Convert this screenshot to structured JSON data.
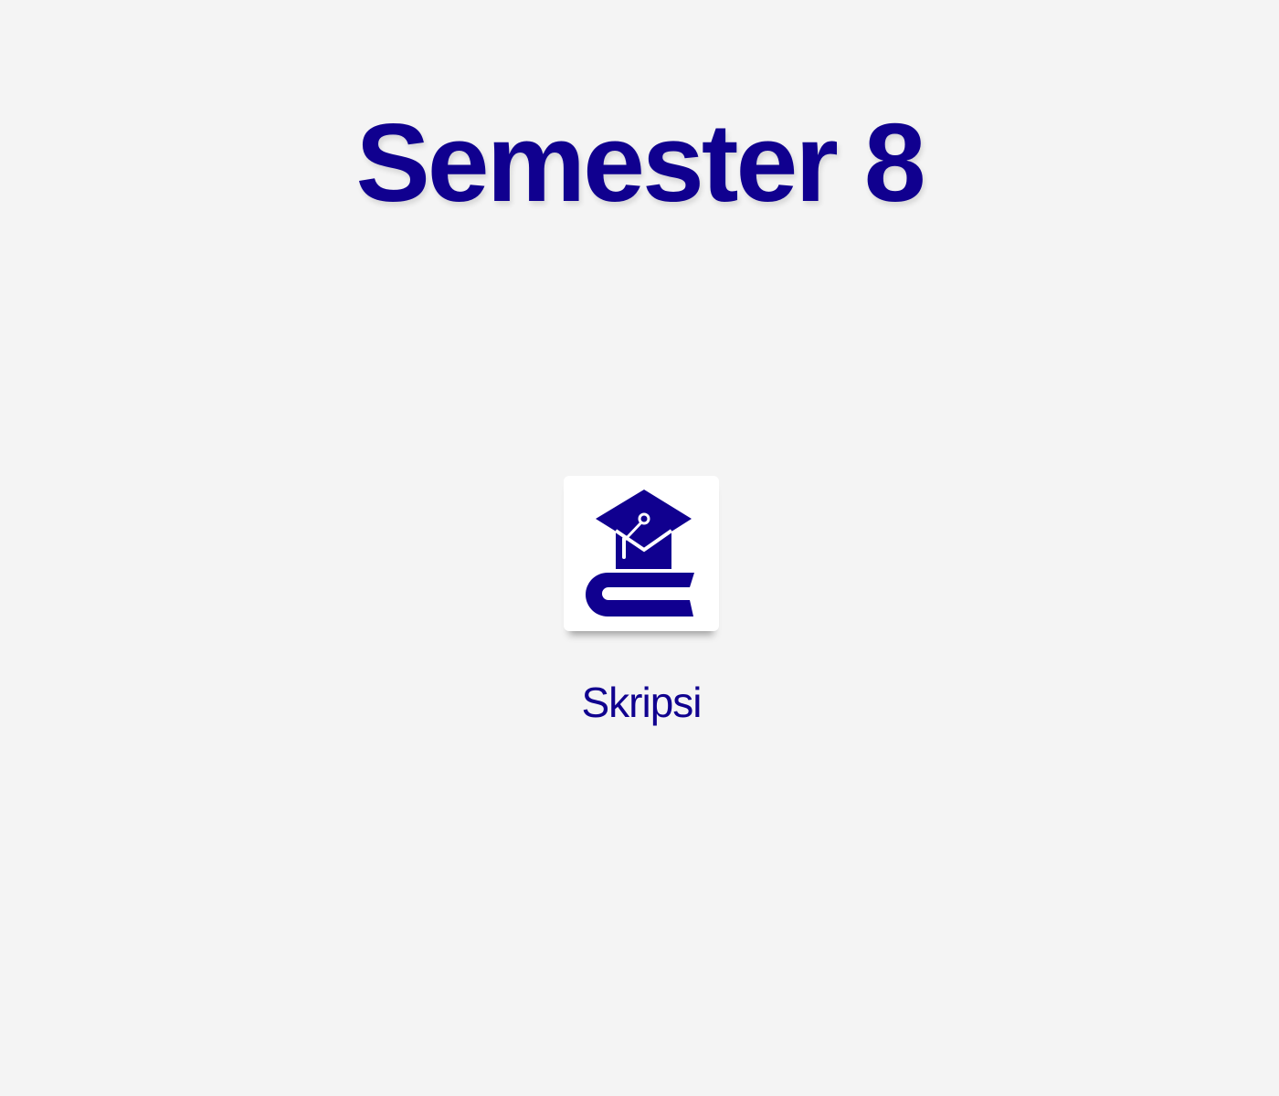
{
  "page": {
    "title": "Semester 8",
    "accent_color": "#10008f",
    "background_color": "#f4f4f4"
  },
  "courses": [
    {
      "label": "Skripsi",
      "icon": "graduation-cap-book-icon"
    }
  ]
}
